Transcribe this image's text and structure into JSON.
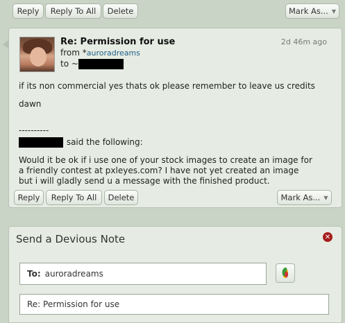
{
  "top_toolbar": {
    "reply_label": "Reply",
    "reply_all_label": "Reply To All",
    "delete_label": "Delete",
    "mark_as_label": "Mark As..."
  },
  "message": {
    "subject": "Re: Permission for use",
    "from_prefix": "from *",
    "from_user": "auroradreams",
    "to_prefix": "to ~",
    "time": "2d 46m ago",
    "body_line1": "if its non commercial yes thats ok please remember to leave us credits",
    "signature": "dawn",
    "separator": "----------",
    "quote_said": "said the following:",
    "quote_line1": "Would it be ok if i use one of your stock images to create an image for",
    "quote_line2": "a friendly contest at pxleyes.com? I have not yet created an image",
    "quote_line3": "but i will gladly send u a message with the finished product."
  },
  "bottom_toolbar": {
    "reply_label": "Reply",
    "reply_all_label": "Reply To All",
    "delete_label": "Delete",
    "mark_as_label": "Mark As..."
  },
  "note_form": {
    "title": "Send a Devious Note",
    "to_label": "To:",
    "to_value": "auroradreams",
    "subject_value": "Re: Permission for use"
  },
  "icons": {
    "close": "close-icon",
    "contacts": "contacts-icon",
    "dropdown": "chevron-down-icon"
  },
  "colors": {
    "background": "#c9d3c6",
    "panel": "#e6ece3",
    "link": "#1f5f8a",
    "close": "#a71d1d"
  }
}
